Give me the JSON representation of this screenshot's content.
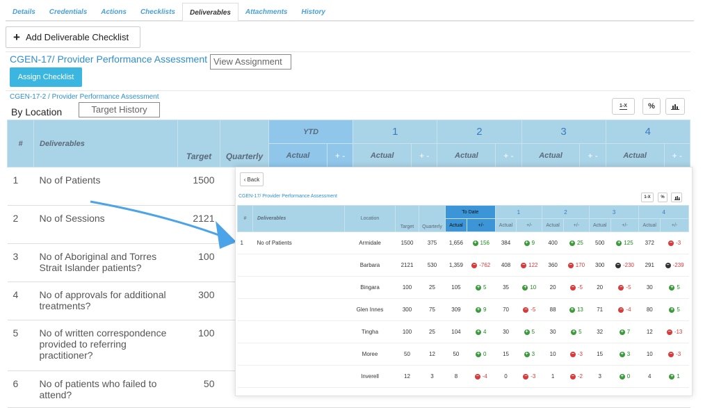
{
  "tabs": [
    "Details",
    "Credentials",
    "Actions",
    "Checklists",
    "Deliverables",
    "Attachments",
    "History"
  ],
  "active_tab": "Deliverables",
  "add_label": "Add Deliverable Checklist",
  "assignment_title": "CGEN-17/ Provider Performance Assessment",
  "view_assignment": "View Assignment",
  "assign_checklist": "Assign Checklist",
  "sub_link": "CGEN-17-2 / Provider Performance Assessment",
  "by_location": "By Location",
  "target_history": "Target History",
  "tools": {
    "oneX": "1-X",
    "percent": "%",
    "chart": "chart-icon"
  },
  "main_headers": {
    "hash": "#",
    "deliverables": "Deliverables",
    "target": "Target",
    "quarterly": "Quarterly",
    "ytd": "YTD",
    "actual": "Actual",
    "plusminus": "+ -",
    "q": [
      "1",
      "2",
      "3",
      "4"
    ]
  },
  "main_rows": [
    {
      "n": "1",
      "name": "No of Patients",
      "target": "1500"
    },
    {
      "n": "2",
      "name": "No of Sessions",
      "target": "2121"
    },
    {
      "n": "3",
      "name": "No of Aboriginal and Torres Strait Islander patients?",
      "target": "100"
    },
    {
      "n": "4",
      "name": "No of approvals for additional treatments?",
      "target": "300"
    },
    {
      "n": "5",
      "name": "No of written correspondence provided to referring practitioner?",
      "target": "100"
    },
    {
      "n": "6",
      "name": "No of patients who failed to attend?",
      "target": "50"
    }
  ],
  "overlay": {
    "back": "Back",
    "title": "CGEN-17/ Provider Performance Assessment",
    "headers": {
      "hash": "#",
      "deliverables": "Deliverables",
      "location": "Location",
      "target": "Target",
      "quarterly": "Quarterly",
      "todate": "To Date",
      "actual": "Actual",
      "pm": "+/-",
      "q": [
        "1",
        "2",
        "3",
        "4"
      ]
    },
    "row_num": "1",
    "row_name": "No of Patients",
    "rows": [
      {
        "loc": "Armidale",
        "target": "1500",
        "quarterly": "375",
        "cells": [
          [
            "1,656",
            "up",
            "156"
          ],
          [
            "384",
            "up",
            "9"
          ],
          [
            "400",
            "up",
            "25"
          ],
          [
            "500",
            "up",
            "125"
          ],
          [
            "372",
            "down",
            "-3"
          ]
        ]
      },
      {
        "loc": "Barbara",
        "target": "2121",
        "quarterly": "530",
        "cells": [
          [
            "1,359",
            "down",
            "-762"
          ],
          [
            "408",
            "down",
            "122"
          ],
          [
            "360",
            "down",
            "170"
          ],
          [
            "300",
            "neu",
            "-230"
          ],
          [
            "291",
            "neu",
            "-239"
          ]
        ]
      },
      {
        "loc": "Bingara",
        "target": "100",
        "quarterly": "25",
        "cells": [
          [
            "105",
            "up",
            "5"
          ],
          [
            "35",
            "up",
            "10"
          ],
          [
            "20",
            "down",
            "-5"
          ],
          [
            "20",
            "down",
            "-5"
          ],
          [
            "30",
            "up",
            "5"
          ]
        ]
      },
      {
        "loc": "Glen Innes",
        "target": "300",
        "quarterly": "75",
        "cells": [
          [
            "309",
            "up",
            "9"
          ],
          [
            "70",
            "down",
            "-5"
          ],
          [
            "88",
            "up",
            "13"
          ],
          [
            "71",
            "down",
            "-4"
          ],
          [
            "80",
            "up",
            "5"
          ]
        ]
      },
      {
        "loc": "Tingha",
        "target": "100",
        "quarterly": "25",
        "cells": [
          [
            "104",
            "up",
            "4"
          ],
          [
            "30",
            "up",
            "5"
          ],
          [
            "30",
            "up",
            "5"
          ],
          [
            "32",
            "up",
            "7"
          ],
          [
            "12",
            "down",
            "-13"
          ]
        ]
      },
      {
        "loc": "Moree",
        "target": "50",
        "quarterly": "12",
        "cells": [
          [
            "50",
            "up",
            "0"
          ],
          [
            "15",
            "up",
            "3"
          ],
          [
            "10",
            "down",
            "-3"
          ],
          [
            "15",
            "up",
            "3"
          ],
          [
            "10",
            "down",
            "-3"
          ]
        ]
      },
      {
        "loc": "Inverell",
        "target": "12",
        "quarterly": "3",
        "cells": [
          [
            "8",
            "down",
            "-4"
          ],
          [
            "0",
            "down",
            "-3"
          ],
          [
            "1",
            "down",
            "-2"
          ],
          [
            "3",
            "up",
            "0"
          ],
          [
            "4",
            "up",
            "1"
          ]
        ]
      }
    ]
  },
  "colors": {
    "accent": "#2e8fd0",
    "header": "#a9d3e6",
    "positive": "#3c9a3c",
    "negative": "#d93a3a",
    "arrow": "#4ba3e8"
  }
}
